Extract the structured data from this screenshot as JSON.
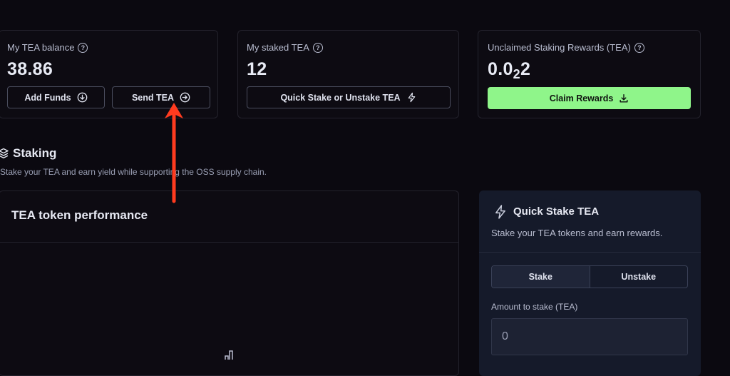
{
  "balance_card": {
    "label": "My TEA balance",
    "value": "38.86",
    "add_funds": "Add Funds",
    "send_tea": "Send TEA"
  },
  "staked_card": {
    "label": "My staked TEA",
    "value": "12",
    "quick_stake": "Quick Stake or Unstake TEA"
  },
  "rewards_card": {
    "label": "Unclaimed Staking Rewards (TEA)",
    "value_main": "0.0",
    "value_sub": "2",
    "value_tail": "2",
    "claim": "Claim Rewards"
  },
  "staking": {
    "title": "Staking",
    "subtitle": "Stake your TEA and earn yield while supporting the OSS supply chain."
  },
  "performance": {
    "title": "TEA token performance"
  },
  "quick_stake": {
    "title": "Quick Stake TEA",
    "subtitle": "Stake your TEA tokens and earn rewards.",
    "tabs": [
      "Stake",
      "Unstake"
    ],
    "amount_label": "Amount to stake (TEA)",
    "amount_value": "0"
  },
  "colors": {
    "accent_green": "#8ff58a",
    "annotation_arrow": "#ff3b1f"
  },
  "icons": [
    "help-icon",
    "download-circle-icon",
    "arrow-right-circle-icon",
    "lightning-icon",
    "download-icon",
    "layers-icon",
    "bar-chart-icon"
  ]
}
